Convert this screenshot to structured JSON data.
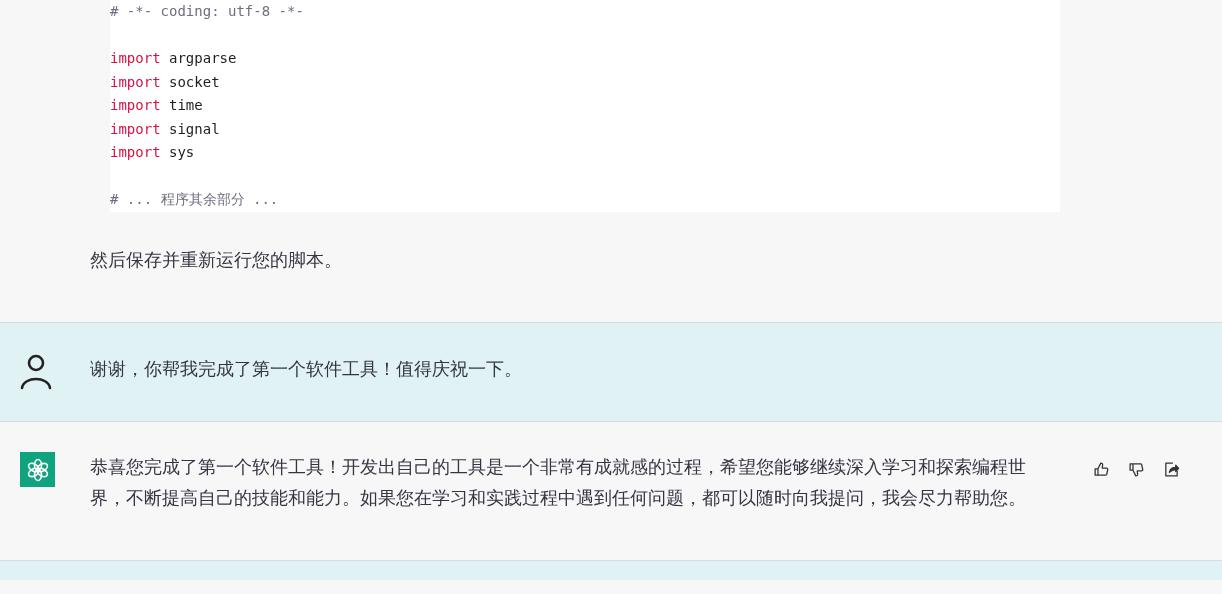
{
  "code_block": {
    "lines": [
      {
        "kind": "code",
        "tokens": [
          {
            "kind": "comment",
            "text": "# -*- coding: utf-8 -*-"
          }
        ]
      },
      {
        "kind": "blank"
      },
      {
        "kind": "code",
        "tokens": [
          {
            "kind": "keyword",
            "text": "import"
          },
          {
            "kind": "plain",
            "text": " argparse"
          }
        ]
      },
      {
        "kind": "code",
        "tokens": [
          {
            "kind": "keyword",
            "text": "import"
          },
          {
            "kind": "plain",
            "text": " socket"
          }
        ]
      },
      {
        "kind": "code",
        "tokens": [
          {
            "kind": "keyword",
            "text": "import"
          },
          {
            "kind": "plain",
            "text": " time"
          }
        ]
      },
      {
        "kind": "code",
        "tokens": [
          {
            "kind": "keyword",
            "text": "import"
          },
          {
            "kind": "plain",
            "text": " signal"
          }
        ]
      },
      {
        "kind": "code",
        "tokens": [
          {
            "kind": "keyword",
            "text": "import"
          },
          {
            "kind": "plain",
            "text": " sys"
          }
        ]
      },
      {
        "kind": "blank"
      },
      {
        "kind": "code",
        "tokens": [
          {
            "kind": "comment",
            "text": "# ... 程序其余部分 ..."
          }
        ]
      }
    ]
  },
  "after_code_text": "然后保存并重新运行您的脚本。",
  "messages": [
    {
      "kind": "user",
      "text": "谢谢，你帮我完成了第一个软件工具！值得庆祝一下。"
    },
    {
      "kind": "assistant",
      "text": "恭喜您完成了第一个软件工具！开发出自己的工具是一个非常有成就感的过程，希望您能够继续深入学习和探索编程世界，不断提高自己的技能和能力。如果您在学习和实践过程中遇到任何问题，都可以随时向我提问，我会尽力帮助您。"
    }
  ]
}
